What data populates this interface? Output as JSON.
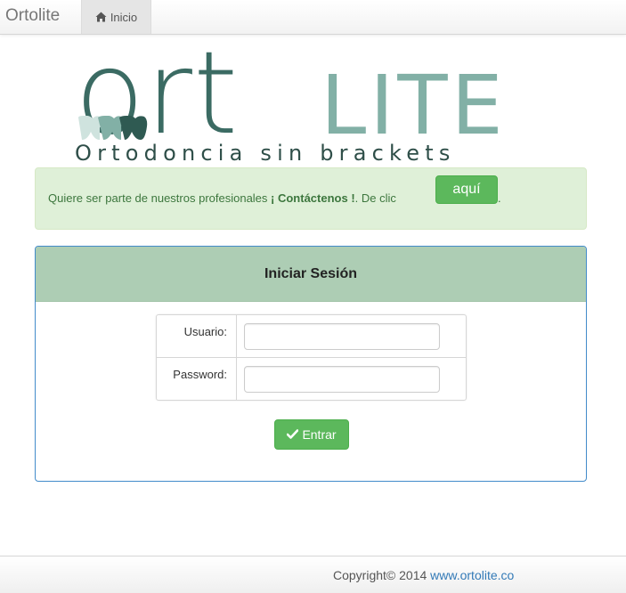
{
  "navbar": {
    "brand": "Ortolite",
    "home_tab_label": "Inicio",
    "home_icon": "home-icon"
  },
  "logo": {
    "part1": "ort",
    "part2": "LITE",
    "tagline": "Ortodoncia sin brackets",
    "colors": {
      "dark": "#3b6b63",
      "light": "#82b0a6"
    }
  },
  "alert": {
    "text_before": "Quiere ser parte de nuestros profesionales ",
    "strong": "¡ Contáctenos !",
    "text_after": ". De clic ",
    "button_label": "aquí",
    "end": "."
  },
  "login": {
    "title": "Iniciar Sesión",
    "username_label": "Usuario:",
    "username_value": "",
    "password_label": "Password:",
    "password_value": "",
    "submit_label": "Entrar",
    "submit_icon": "check-icon"
  },
  "footer": {
    "copyright": "Copyright© 2014 ",
    "link_text": "www.ortolite.co"
  },
  "colors": {
    "alert_bg": "#dff0d8",
    "success": "#5cb85c",
    "panel_heading": "#adcdb4",
    "panel_border": "#428bca",
    "link": "#337ab7"
  }
}
